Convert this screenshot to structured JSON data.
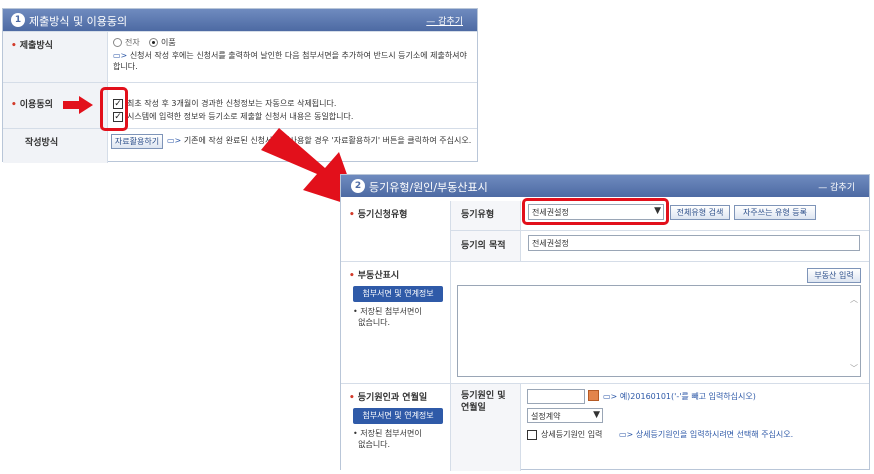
{
  "panel1": {
    "number": "1",
    "title": "제출방식 및 이용동의",
    "fold": "감추기",
    "submit_method": {
      "label": "제출방식",
      "option_electronic": "전자",
      "option_paper": "이품",
      "selected": "이품",
      "note": "신청서 작성 후에는 신청서를 출력하여 날인한 다음 첨부서면을 추가하여 반드시 등기소에 제출하셔야 합니다."
    },
    "consent": {
      "label": "이용동의",
      "line1": "최초 작성 후 3개월이 경과한 신청정보는 자동으로 삭제됩니다.",
      "line2": "시스템에 입력한 정보와 등기소로 제출할 신청서 내용은 동일합니다.",
      "checked1": true,
      "checked2": true
    },
    "method": {
      "label": "작성방식",
      "button": "자료활용하기",
      "note": "기존에 작성 완료된 신청서를 재사용할 경우 '자료활용하기' 버튼을 클릭하여 주십시오."
    }
  },
  "panel2": {
    "number": "2",
    "title": "등기유형/원인/부동산표시",
    "fold": "감추기",
    "apply_type": {
      "label": "등기신청유형",
      "type_label": "등기유형",
      "type_value": "전세권설정",
      "search_button": "전체유형 검색",
      "frequent_button": "자주쓰는 유형 등록",
      "purpose_label": "등기의 목적",
      "purpose_value": "전세권설정"
    },
    "property": {
      "label": "부동산표시",
      "attach_button": "첨부서면 및 연계정보",
      "saved_note_line1": "저장된 첨부서면이",
      "saved_note_line2": "없습니다.",
      "input_button": "부동산 입력"
    },
    "cause": {
      "label": "등기원인과 연월일",
      "attach_button": "첨부서면 및 연계정보",
      "saved_note_line1": "저장된 첨부서면이",
      "saved_note_line2": "없습니다.",
      "sub_label_line1": "등기원인 및",
      "sub_label_line2": "연월일",
      "date_value": "",
      "date_hint": "예)20160101('-'를 빼고 입력하십시오)",
      "cause_select": "설정계약",
      "detail_check_label": "상세등기원인 입력",
      "detail_hint": "상세등기원인을 입력하시려면 선택해 주십시오."
    }
  },
  "colors": {
    "header": "#4d6aa3",
    "highlight": "#e2101b",
    "accent_text": "#d23b2b"
  }
}
